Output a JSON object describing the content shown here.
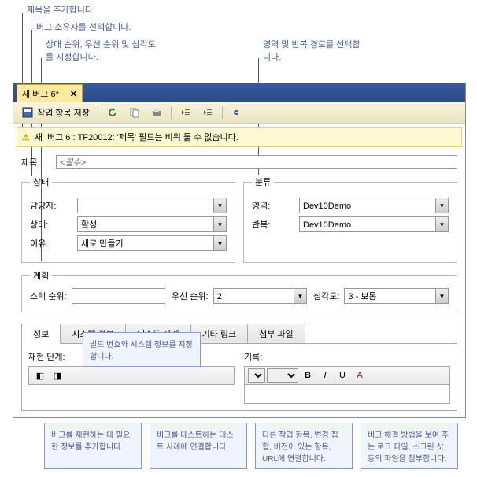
{
  "callouts": {
    "top1": "제목을 추가합니다.",
    "top2": "버그 소유자를 선택합니다.",
    "top3": "상대 순위, 우선 순위 및 심각도를 지정합니다.",
    "top4": "영역 및 반복 경로를 선택합니다."
  },
  "tab": {
    "label": "새 버그 6*",
    "close": "✕"
  },
  "toolbar": {
    "save_label": "작업 항목 저장"
  },
  "warning": {
    "prefix": "새",
    "text": "버그 6 : TF20012: '제목' 필드는 비워 둘 수 없습니다."
  },
  "form": {
    "title_label": "제목:",
    "title_placeholder": "<필수>",
    "status_legend": "상태",
    "assignee_label": "담당자:",
    "assignee_value": "",
    "state_label": "상태:",
    "state_value": "활성",
    "reason_label": "이유:",
    "reason_value": "새로 만들기",
    "class_legend": "분류",
    "area_label": "영역:",
    "area_value": "Dev10Demo",
    "iter_label": "반복:",
    "iter_value": "Dev10Demo",
    "plan_legend": "계획",
    "stack_label": "스택 순위:",
    "stack_value": "",
    "priority_label": "우선 순위:",
    "priority_value": "2",
    "severity_label": "심각도:",
    "severity_value": "3 - 보통"
  },
  "lower_tabs": [
    "정보",
    "시스템 정보",
    "테스트 사례",
    "기타 링크",
    "첨부 파일"
  ],
  "lower": {
    "repro_label": "재현 단계:",
    "history_label": "기록:"
  },
  "inline_annot": "빌드 번호와 시스템 정보를 지정합니다.",
  "bottom_annots": [
    "버그를 재현하는 데 필요한 정보를 추가합니다.",
    "버그를 테스트하는 테스트 사례에 연결합니다.",
    "다른 작업 항목, 변경 집합, 버전이 있는 항목, URL에 연결합니다.",
    "버그 해결 방법을 보여 주는 로그 파일, 스크린 샷 등의 파일을 첨부합니다."
  ]
}
